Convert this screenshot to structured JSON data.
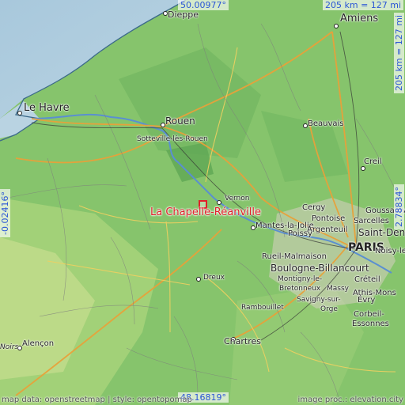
{
  "map": {
    "place_name": "La Chapelle-Réanville",
    "coords": {
      "north": "50.00977°",
      "south": "48.16819°",
      "west": "-0.02416°",
      "east": "2.78834°"
    },
    "scale": {
      "horizontal": "205 km = 127 mi",
      "vertical": "205 km = 127 mi"
    },
    "credits": {
      "left": "map data: openstreetmap | style: opentopomap",
      "right": "image proc.: elevation.city"
    },
    "cities": [
      "Dieppe",
      "Amiens",
      "Le Havre",
      "Rouen",
      "Sotteville-lès-Rouen",
      "Beauvais",
      "Creil",
      "Vernon",
      "Cergy",
      "Pontoise",
      "Goussainville",
      "Sarcelles",
      "Mantes-la-Jolie",
      "Argenteuil",
      "Saint-Denis",
      "Poissy",
      "PARIS",
      "Rueil-Malmaison",
      "Boulogne-Billancourt",
      "Noisy-le",
      "Dreux",
      "Montigny-le-",
      "Bretonneux",
      "Massy",
      "Créteil",
      "Savigny-sur-",
      "Athis-Mons",
      "Orge",
      "Évry",
      "Rambouillet",
      "Corbeil-",
      "Essonnes",
      "Chartres",
      "Alençon",
      "Noirs"
    ]
  }
}
